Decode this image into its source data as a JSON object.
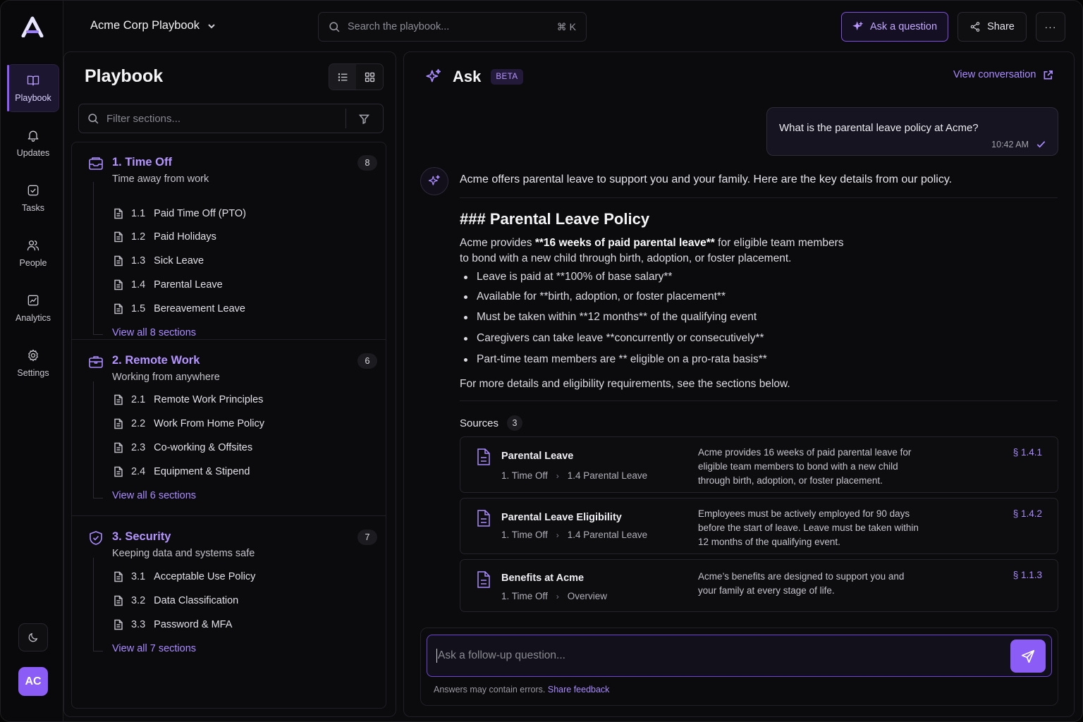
{
  "workspace": {
    "name": "Acme Corp Playbook"
  },
  "search": {
    "placeholder": "Search the playbook...",
    "shortcut": "⌘ K"
  },
  "header": {
    "ask_label": "Ask a question",
    "share_label": "Share",
    "more_label": "···"
  },
  "rail": {
    "items": [
      {
        "label": "Playbook",
        "icon": "book-icon",
        "active": true
      },
      {
        "label": "Updates",
        "icon": "bell-icon"
      },
      {
        "label": "Tasks",
        "icon": "checkbox-icon"
      },
      {
        "label": "People",
        "icon": "users-icon"
      },
      {
        "label": "Analytics",
        "icon": "chart-icon"
      },
      {
        "label": "Settings",
        "icon": "gear-icon"
      }
    ],
    "avatar_initials": "AC"
  },
  "playbook": {
    "title": "Playbook",
    "filter_placeholder": "Filter sections...",
    "sections": [
      {
        "title": "1. Time Off",
        "subtitle": "Time away from work",
        "count": "8",
        "items": [
          {
            "num": "1.1",
            "label": "Paid Time Off (PTO)"
          },
          {
            "num": "1.2",
            "label": "Paid Holidays"
          },
          {
            "num": "1.3",
            "label": "Sick Leave"
          },
          {
            "num": "1.4",
            "label": "Parental Leave"
          },
          {
            "num": "1.5",
            "label": "Bereavement Leave"
          }
        ],
        "view_all": "View all 8 sections"
      },
      {
        "title": "2. Remote Work",
        "subtitle": "Working from anywhere",
        "count": "6",
        "items": [
          {
            "num": "2.1",
            "label": "Remote Work Principles"
          },
          {
            "num": "2.2",
            "label": "Work From Home Policy"
          },
          {
            "num": "2.3",
            "label": "Co-working & Offsites"
          },
          {
            "num": "2.4",
            "label": "Equipment & Stipend"
          }
        ],
        "view_all": "View all 6 sections"
      },
      {
        "title": "3. Security",
        "subtitle": "Keeping data and systems safe",
        "count": "7",
        "items": [
          {
            "num": "3.1",
            "label": "Acceptable Use Policy"
          },
          {
            "num": "3.2",
            "label": "Data Classification"
          },
          {
            "num": "3.3",
            "label": "Password & MFA"
          }
        ],
        "view_all": "View all 7 sections"
      }
    ]
  },
  "ask": {
    "title": "Ask",
    "badge": "BETA",
    "view_conversation": "View conversation",
    "user_message": {
      "text": "What is the parental leave policy at Acme?",
      "time": "10:42 AM"
    },
    "answer": {
      "intro": "Acme offers parental leave to support you and your family. Here are the key details from our policy.",
      "heading": "### Parental Leave Policy",
      "para_pre": "Acme provides ",
      "para_bold": "**16 weeks of paid parental leave**",
      "para_post": " for eligible team members",
      "para_line2": "to bond with a new child through birth, adoption, or foster placement.",
      "bullets": [
        "Leave is paid at **100% of base salary**",
        "Available for **birth, adoption, or foster placement**",
        "Must be taken within **12 months** of the qualifying event",
        "Caregivers can take leave **concurrently or consecutively**",
        "Part-time team members are ** eligible on a pro-rata basis**"
      ],
      "closing": "For more details and eligibility requirements, see the sections below."
    },
    "sources_label": "Sources",
    "sources_count": "3",
    "sources": [
      {
        "title": "Parental Leave",
        "path1": "1. Time Off",
        "path2": "1.4 Parental Leave",
        "desc": "Acme provides 16 weeks of paid parental leave for eligible team members to bond with a new child through birth, adoption, or foster placement.",
        "ref": "§ 1.4.1"
      },
      {
        "title": "Parental Leave Eligibility",
        "path1": "1. Time Off",
        "path2": "1.4 Parental Leave",
        "desc": "Employees must be actively employed for 90 days before the start of leave. Leave must be taken within 12 months of the qualifying event.",
        "ref": "§ 1.4.2"
      },
      {
        "title": "Benefits at Acme",
        "path1": "1. Time Off",
        "path2": "Overview",
        "desc": "Acme’s benefits are designed to support you and your family at every stage of life.",
        "ref": "§ 1.1.3"
      }
    ],
    "composer_placeholder": "Ask a follow-up question...",
    "disclaimer": "Answers may contain errors.",
    "feedback_link": "Share feedback"
  },
  "colors": {
    "accent": "#8b5cf6",
    "accent_text": "#a98bff",
    "background": "#0b0b0d"
  }
}
